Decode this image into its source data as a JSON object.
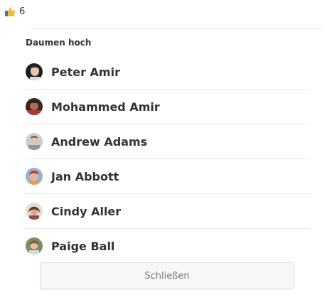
{
  "reaction": {
    "icon": "thumbs-up-icon",
    "count": "6",
    "color": "#f2b84b"
  },
  "dialog": {
    "title": "Daumen hoch",
    "users": [
      {
        "name": "Peter Amir",
        "avatar": "avatar-photo"
      },
      {
        "name": "Mohammed Amir",
        "avatar": "avatar-photo"
      },
      {
        "name": "Andrew Adams",
        "avatar": "avatar-photo"
      },
      {
        "name": "Jan Abbott",
        "avatar": "avatar-photo"
      },
      {
        "name": "Cindy Aller",
        "avatar": "avatar-photo"
      },
      {
        "name": "Paige Ball",
        "avatar": "avatar-photo"
      }
    ],
    "close_label": "Schließen"
  }
}
